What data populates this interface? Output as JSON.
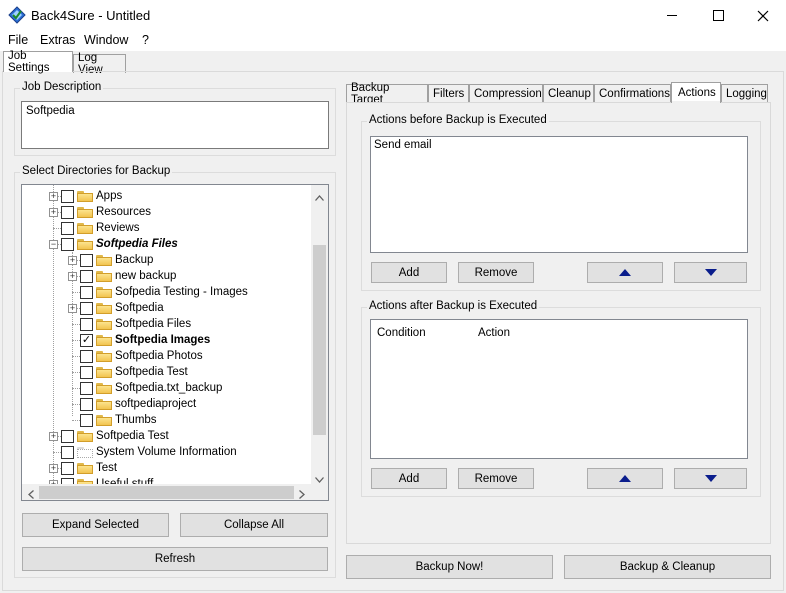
{
  "window": {
    "title": "Back4Sure - Untitled",
    "minimize": "—",
    "maximize": "☐",
    "close": "✕"
  },
  "menu": [
    "File",
    "Extras",
    "Window",
    "?"
  ],
  "main_tabs": [
    {
      "label": "Job Settings",
      "active": true
    },
    {
      "label": "Log View",
      "active": false
    }
  ],
  "job_description": {
    "label": "Job Description",
    "value": "Softpedia"
  },
  "directories": {
    "label": "Select Directories for Backup",
    "items": [
      {
        "label": "Apps",
        "level": 0,
        "expander": "+",
        "checked": false,
        "bold": false,
        "italic": false
      },
      {
        "label": "Resources",
        "level": 0,
        "expander": "+",
        "checked": false,
        "bold": false,
        "italic": false
      },
      {
        "label": "Reviews",
        "level": 0,
        "expander": "",
        "checked": false,
        "bold": false,
        "italic": false
      },
      {
        "label": "Softpedia Files",
        "level": 0,
        "expander": "-",
        "checked": false,
        "bold": true,
        "italic": true
      },
      {
        "label": "Backup",
        "level": 1,
        "expander": "+",
        "checked": false,
        "bold": false,
        "italic": false
      },
      {
        "label": "new backup",
        "level": 1,
        "expander": "+",
        "checked": false,
        "bold": false,
        "italic": false
      },
      {
        "label": "Sofpedia Testing - Images",
        "level": 1,
        "expander": "",
        "checked": false,
        "bold": false,
        "italic": false
      },
      {
        "label": "Softpedia",
        "level": 1,
        "expander": "+",
        "checked": false,
        "bold": false,
        "italic": false
      },
      {
        "label": "Softpedia Files",
        "level": 1,
        "expander": "",
        "checked": false,
        "bold": false,
        "italic": false
      },
      {
        "label": "Softpedia Images",
        "level": 1,
        "expander": "",
        "checked": true,
        "bold": true,
        "italic": false
      },
      {
        "label": "Softpedia Photos",
        "level": 1,
        "expander": "",
        "checked": false,
        "bold": false,
        "italic": false
      },
      {
        "label": "Softpedia Test",
        "level": 1,
        "expander": "",
        "checked": false,
        "bold": false,
        "italic": false
      },
      {
        "label": "Softpedia.txt_backup",
        "level": 1,
        "expander": "",
        "checked": false,
        "bold": false,
        "italic": false
      },
      {
        "label": "softpediaproject",
        "level": 1,
        "expander": "",
        "checked": false,
        "bold": false,
        "italic": false
      },
      {
        "label": "Thumbs",
        "level": 1,
        "expander": "",
        "checked": false,
        "bold": false,
        "italic": false
      },
      {
        "label": "Softpedia Test",
        "level": 0,
        "expander": "+",
        "checked": false,
        "bold": false,
        "italic": false
      },
      {
        "label": "System Volume Information",
        "level": 0,
        "expander": "",
        "checked": false,
        "bold": false,
        "italic": false,
        "system": true
      },
      {
        "label": "Test",
        "level": 0,
        "expander": "+",
        "checked": false,
        "bold": false,
        "italic": false
      },
      {
        "label": "Useful stuff",
        "level": 0,
        "expander": "+",
        "checked": false,
        "bold": false,
        "italic": false
      }
    ]
  },
  "left_buttons": {
    "expand": "Expand Selected",
    "collapse": "Collapse All",
    "refresh": "Refresh"
  },
  "settings_tabs": [
    {
      "label": "Backup Target",
      "active": false
    },
    {
      "label": "Filters",
      "active": false
    },
    {
      "label": "Compression",
      "active": false
    },
    {
      "label": "Cleanup",
      "active": false
    },
    {
      "label": "Confirmations",
      "active": false
    },
    {
      "label": "Actions",
      "active": true
    },
    {
      "label": "Logging",
      "active": false
    }
  ],
  "actions_before": {
    "label": "Actions before Backup is Executed",
    "items": [
      "Send email"
    ],
    "add": "Add",
    "remove": "Remove"
  },
  "actions_after": {
    "label": "Actions after Backup is Executed",
    "columns": [
      "Condition",
      "Action"
    ],
    "add": "Add",
    "remove": "Remove"
  },
  "bottom_buttons": {
    "backup_now": "Backup Now!",
    "backup_cleanup": "Backup & Cleanup"
  },
  "colors": {
    "accent_arrow": "#0a1d8c",
    "window_bg": "#f0f0f0"
  }
}
